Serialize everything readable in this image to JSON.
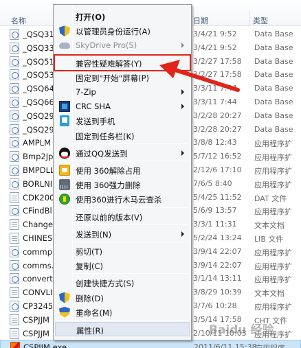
{
  "columns": {
    "name": "名称",
    "date": "日期",
    "type": "类型"
  },
  "files": [
    {
      "name": "_QSQ31",
      "date": "3/4/21 9:52",
      "type": "Data Base",
      "icon": "exe"
    },
    {
      "name": "_QSQ33",
      "date": "3/4/21 9:52",
      "type": "Data Base",
      "icon": "exe"
    },
    {
      "name": "_QSQ51",
      "date": "3/2/27 17:58",
      "type": "Data Base",
      "icon": "exe"
    },
    {
      "name": "_QSQ53",
      "date": "3/2/27 17:58",
      "type": "Data Base",
      "icon": "exe"
    },
    {
      "name": "_QSQ64",
      "date": "3/3/11 7:44",
      "type": "Data Base",
      "icon": "exe"
    },
    {
      "name": "_QSQ66",
      "date": "3/3/11 7:44",
      "type": "Data Base",
      "icon": "exe"
    },
    {
      "name": "_QSQ29",
      "date": "3/2/28 20:27",
      "type": "Data Base",
      "icon": "exe"
    },
    {
      "name": "_QSQ29",
      "date": "3/2/28 20:27",
      "type": "Data Base",
      "icon": "exe"
    },
    {
      "name": "AMPLM",
      "date": "3/8/8 12:43",
      "type": "应用程序扩",
      "icon": "exe"
    },
    {
      "name": "Bmp2Jp",
      "date": "5/7/12 16:52",
      "type": "应用程序扩",
      "icon": "exe"
    },
    {
      "name": "BMPDLL",
      "date": "2/12/6 17:10",
      "type": "应用程序扩",
      "icon": "exe"
    },
    {
      "name": "BORLNI",
      "date": "7/6/5 8:40",
      "type": "应用程序扩",
      "icon": "exe"
    },
    {
      "name": "CDK200",
      "date": "5/4/25 11:52",
      "type": "DAT 文件",
      "icon": "doc"
    },
    {
      "name": "CFindBl",
      "date": "5/6/9 13:57",
      "type": "应用程序扩",
      "icon": "exe"
    },
    {
      "name": "Change",
      "date": "3/3/1 11:31",
      "type": "文本文档",
      "icon": "doc"
    },
    {
      "name": "CHINES",
      "date": "5/2/24 13:24",
      "type": "LIB 文件",
      "icon": "doc"
    },
    {
      "name": "commp",
      "date": "3/9/14 22:07",
      "type": "应用程序扩",
      "icon": "exe"
    },
    {
      "name": "comms.",
      "date": "3/9/14 22:07",
      "type": "应用程序扩",
      "icon": "exe"
    },
    {
      "name": "convert",
      "date": "3/1/14 13:11",
      "type": "应用程序扩",
      "icon": "exe"
    },
    {
      "name": "CONVLI",
      "date": "3/8/29 10:39",
      "type": "文本文档",
      "icon": "doc"
    },
    {
      "name": "CP3245I",
      "date": "3/7/6 10:28",
      "type": "应用程序扩",
      "icon": "exe"
    },
    {
      "name": "CSPJJM",
      "date": "3/5/14 17:58",
      "type": "CHT 文件",
      "icon": "doc"
    },
    {
      "name": "CSPJJM",
      "date": "2/10/11 10:03",
      "type": "应用程序扩",
      "icon": "doc"
    },
    {
      "name": "CSPJJM.exe",
      "date": "2011/6/11 15:38",
      "type": "应用程序",
      "icon": "app"
    }
  ],
  "menu": {
    "items": [
      {
        "key": "open",
        "label": "打开(O)",
        "bold": true
      },
      {
        "key": "run-as-admin",
        "label": "以管理员身份运行(A)",
        "icon": "shield"
      },
      {
        "key": "skydrive",
        "label": "SkyDrive Pro(S)",
        "disabled": true,
        "submenu": true,
        "icon": "cloud"
      },
      {
        "sep": true
      },
      {
        "key": "troubleshoot-compat",
        "label": "兼容性疑难解答(Y)",
        "boxed": true
      },
      {
        "key": "pin-to-start",
        "label": "固定到\"开始\"屏幕(P)"
      },
      {
        "key": "7zip",
        "label": "7-Zip",
        "submenu": true
      },
      {
        "key": "crc-sha",
        "label": "CRC SHA",
        "submenu": true,
        "icon": "crc"
      },
      {
        "key": "send-to-phone",
        "label": "发送到手机",
        "icon": "phone"
      },
      {
        "key": "pin-to-taskbar",
        "label": "固定到任务栏(K)"
      },
      {
        "sep": true
      },
      {
        "key": "send-via-qq",
        "label": "通过QQ发送到",
        "submenu": true,
        "icon": "qq"
      },
      {
        "sep": true
      },
      {
        "key": "360-unlock",
        "label": "使用 360解除占用",
        "icon": "unlock"
      },
      {
        "key": "360-shred",
        "label": "使用 360强力删除",
        "icon": "shred"
      },
      {
        "key": "360-scan",
        "label": "使用360进行木马云查杀",
        "icon": "scan"
      },
      {
        "sep": true
      },
      {
        "key": "restore-previous",
        "label": "还原以前的版本(V)"
      },
      {
        "sep": true
      },
      {
        "key": "send-to",
        "label": "发送到(N)",
        "submenu": true
      },
      {
        "sep": true
      },
      {
        "key": "cut",
        "label": "剪切(T)"
      },
      {
        "key": "copy",
        "label": "复制(C)"
      },
      {
        "sep": true
      },
      {
        "key": "create-shortcut",
        "label": "创建快捷方式(S)"
      },
      {
        "key": "delete",
        "label": "删除(D)",
        "icon": "shield"
      },
      {
        "key": "rename",
        "label": "重命名(M)",
        "icon": "shield2"
      },
      {
        "sep": true
      },
      {
        "key": "properties",
        "label": "属性(R)",
        "highlight": true
      }
    ]
  },
  "annotation": {
    "arrow_color": "#e1251b",
    "box_color": "#e1251b"
  },
  "watermark": "Baidu 经验"
}
